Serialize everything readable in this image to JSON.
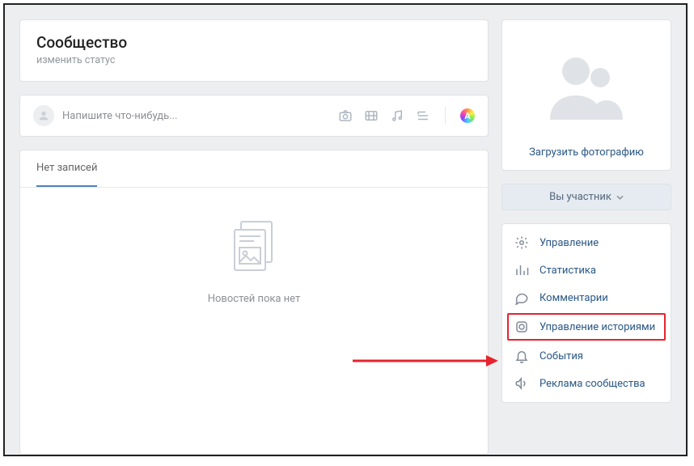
{
  "header": {
    "title": "Сообщество",
    "status_link": "изменить статус"
  },
  "composer": {
    "placeholder": "Напишите что-нибудь..."
  },
  "posts": {
    "tab_label": "Нет записей",
    "empty_message": "Новостей пока нет"
  },
  "sidebar": {
    "upload_label": "Загрузить фотографию",
    "membership_label": "Вы участник",
    "menu": [
      {
        "label": "Управление"
      },
      {
        "label": "Статистика"
      },
      {
        "label": "Комментарии"
      },
      {
        "label": "Управление историями"
      },
      {
        "label": "События"
      },
      {
        "label": "Реклама сообщества"
      }
    ]
  },
  "icons": {
    "rainbow_letter": "A"
  }
}
